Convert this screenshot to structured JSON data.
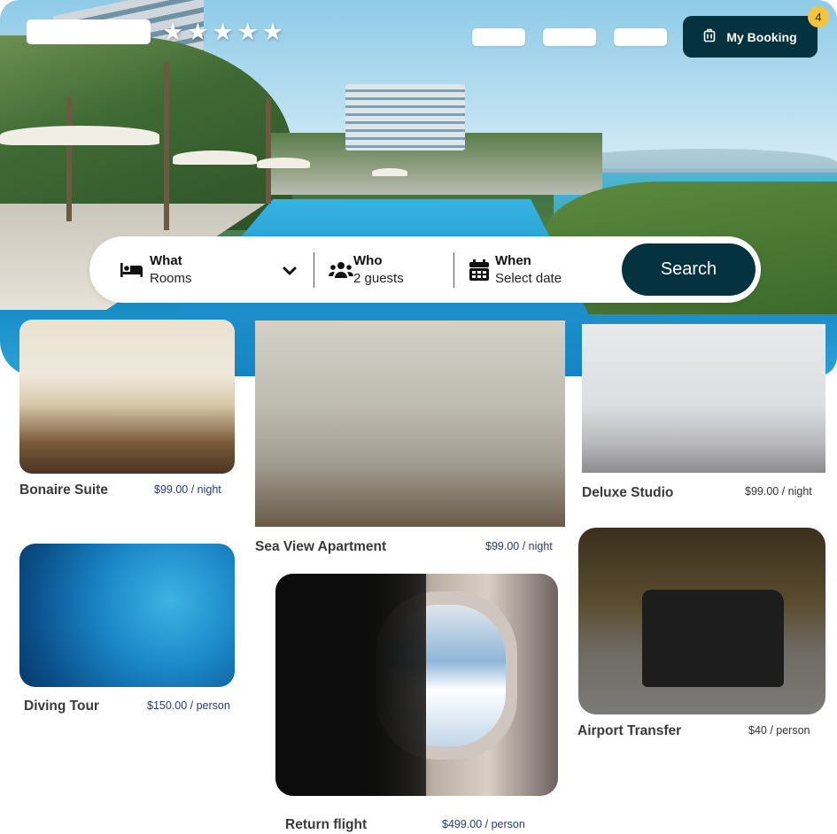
{
  "header": {
    "rating_stars": 5,
    "nav_items": [
      "",
      "",
      ""
    ],
    "booking_button_label": "My Booking",
    "booking_icon": "luggage-icon",
    "booking_badge_count": "4"
  },
  "search": {
    "what": {
      "label": "What",
      "value": "Rooms",
      "icon": "bed-icon"
    },
    "who": {
      "label": "Who",
      "value": "2 guests",
      "icon": "users-icon"
    },
    "when": {
      "label": "When",
      "value": "Select date",
      "icon": "calendar-icon"
    },
    "button_label": "Search"
  },
  "cards": [
    {
      "title": "Bonaire Suite",
      "price": "$99.00 / night"
    },
    {
      "title": "Sea View Apartment",
      "price": "$99.00 / night"
    },
    {
      "title": "Deluxe Studio",
      "price": "$99.00 / night"
    },
    {
      "title": "Diving Tour",
      "price": "$150.00 / person"
    },
    {
      "title": "Return flight",
      "price": "$499.00 / person"
    },
    {
      "title": "Airport Transfer",
      "price": "$40 / person"
    }
  ],
  "colors": {
    "primary": "#04323f",
    "badge": "#f6c33c",
    "price_text": "#2a3a7a"
  }
}
